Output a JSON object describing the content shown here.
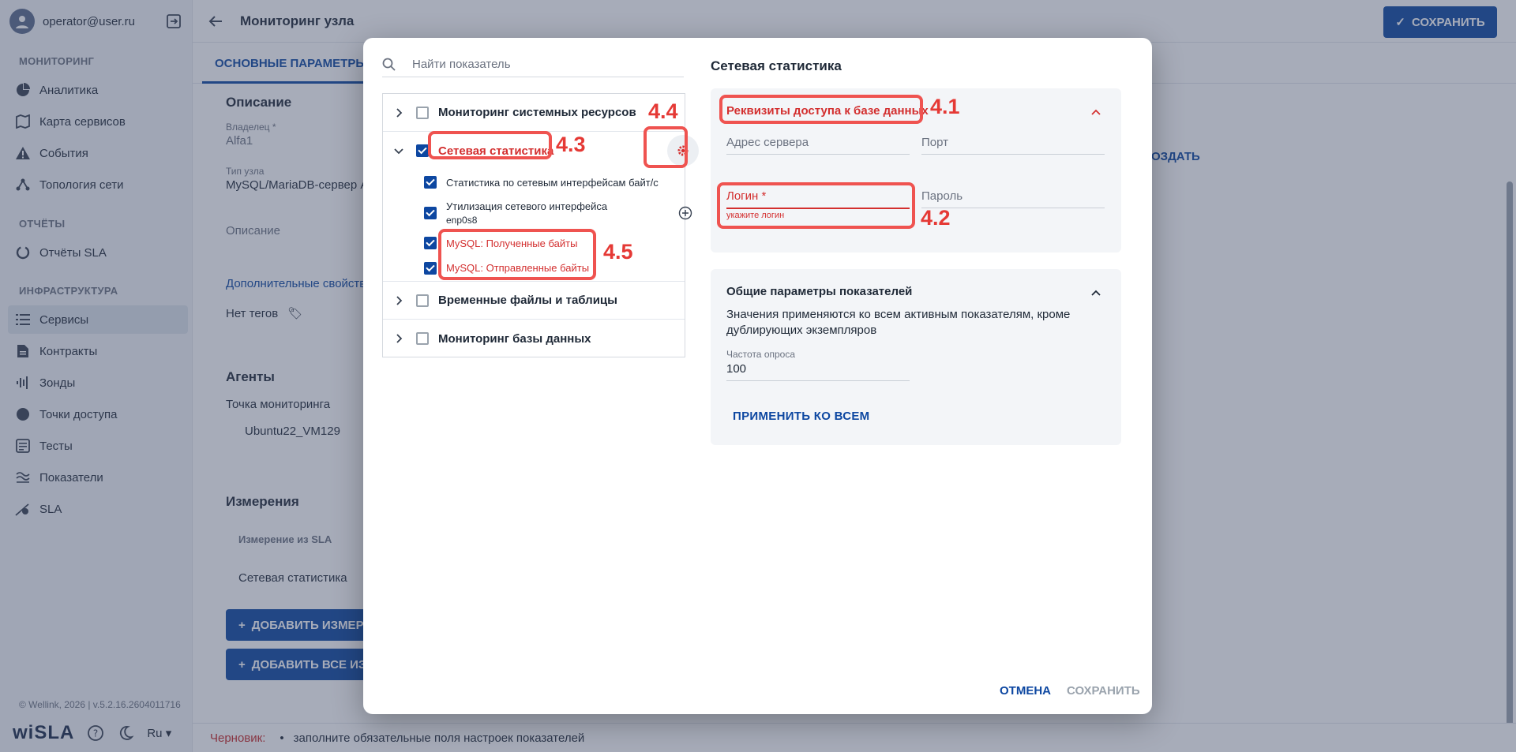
{
  "user": {
    "email": "operator@user.ru"
  },
  "sidebar": {
    "sections": [
      {
        "title": "МОНИТОРИНГ",
        "items": [
          "Аналитика",
          "Карта сервисов",
          "События",
          "Топология сети"
        ]
      },
      {
        "title": "ОТЧЁТЫ",
        "items": [
          "Отчёты SLA"
        ]
      },
      {
        "title": "ИНФРАСТРУКТУРА",
        "items": [
          "Сервисы",
          "Контракты",
          "Зонды",
          "Точки доступа",
          "Тесты",
          "Показатели",
          "SLA"
        ]
      }
    ],
    "active": "Сервисы",
    "footer": "© Wellink, 2026 | v.5.2.16.2604011716",
    "brand": "wiSLA",
    "lang": "Ru"
  },
  "header": {
    "title": "Мониторинг узла",
    "save": "СОХРАНИТЬ",
    "tab": "ОСНОВНЫЕ ПАРАМЕТРЫ"
  },
  "content": {
    "description_h": "Описание",
    "owner_label": "Владелец *",
    "owner_value": "Alfa1",
    "type_label": "Тип узла",
    "type_value": "MySQL/MariaDB-сервер А",
    "desc_field": "Описание",
    "extra_link": "Дополнительные свойства",
    "no_tags": "Нет тегов",
    "agents_h": "Агенты",
    "monitor_point": "Точка мониторинга",
    "agent_name": "Ubuntu22_VM129",
    "measure_h": "Измерения",
    "measure_col": "Измерение из SLA",
    "measure_row": "Сетевая статистика",
    "add_measure": "ДОБАВИТЬ ИЗМЕРЕНИЕ",
    "add_all": "ДОБАВИТЬ ВСЕ ИЗМЕРЕНИЯ",
    "create": "ОЗДАТЬ"
  },
  "status": {
    "draft": "Черновик:",
    "message": "заполните обязательные поля настроек показателей"
  },
  "modal": {
    "search_placeholder": "Найти показатель",
    "tree": {
      "g1": "Мониторинг системных ресурсов",
      "g2": "Сетевая статистика",
      "g2_children": [
        {
          "label": "Статистика по сетевым интерфейсам байт/с"
        },
        {
          "label": "Утилизация сетевого интерфейса",
          "sub": "enp0s8"
        },
        {
          "label": "MySQL: Полученные байты"
        },
        {
          "label": "MySQL: Отправленные байты"
        }
      ],
      "g3": "Временные файлы и таблицы",
      "g4": "Мониторинг базы данных"
    },
    "right_title": "Сетевая статистика",
    "db_panel": {
      "title": "Реквизиты доступа к базе данных",
      "server": "Адрес сервера",
      "port": "Порт",
      "login": "Логин *",
      "login_error": "укажите логин",
      "password": "Пароль"
    },
    "common_panel": {
      "title": "Общие параметры показателей",
      "note": "Значения применяются ко всем активным показателям, кроме дублирующих экземпляров",
      "freq_label": "Частота опроса",
      "freq_value": "100",
      "apply": "ПРИМЕНИТЬ КО ВСЕМ"
    },
    "cancel": "ОТМЕНА",
    "save": "СОХРАНИТЬ"
  },
  "annotations": [
    "4.1",
    "4.2",
    "4.3",
    "4.4",
    "4.5"
  ],
  "colors": {
    "primary": "#0d47a1",
    "error": "#d32f2f",
    "annotation": "#e53935"
  }
}
